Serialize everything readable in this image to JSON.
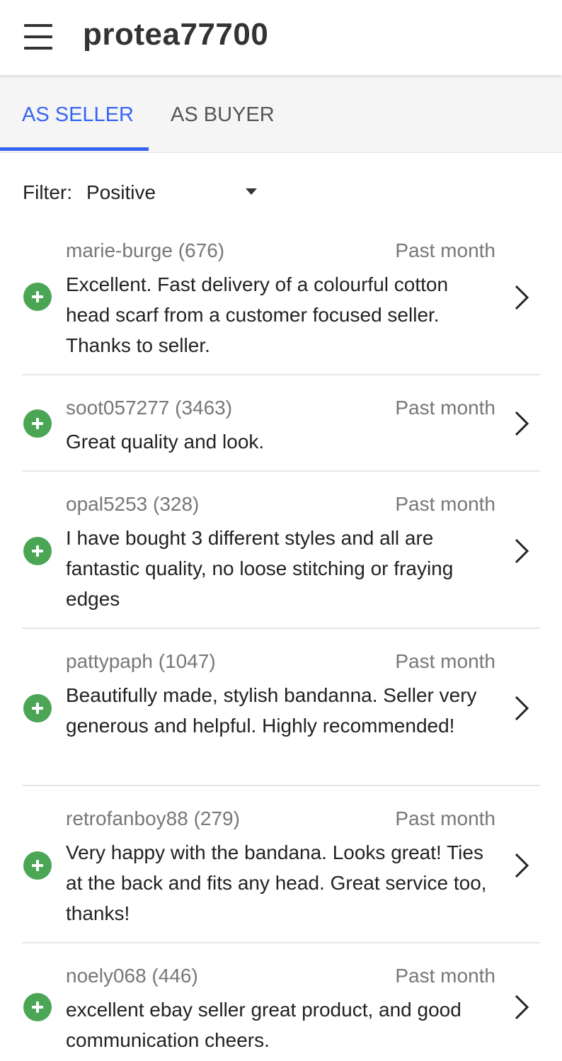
{
  "header": {
    "title": "protea77700",
    "menu_icon": "hamburger-menu-icon"
  },
  "tabs": [
    {
      "label": "AS SELLER",
      "selected": true
    },
    {
      "label": "AS BUYER",
      "selected": false
    }
  ],
  "filter": {
    "label": "Filter:",
    "value": "Positive"
  },
  "colors": {
    "accent": "#3665f3",
    "positive": "#4aa555",
    "muted_text": "#777777"
  },
  "feedback": [
    {
      "user": "marie-burge (676)",
      "time": "Past month",
      "comment": "Excellent. Fast delivery of a colourful cotton head scarf from a customer focused seller. Thanks to seller.",
      "rating_icon": "positive-plus-icon"
    },
    {
      "user": "soot057277 (3463)",
      "time": "Past month",
      "comment": "Great quality and look.",
      "rating_icon": "positive-plus-icon"
    },
    {
      "user": "opal5253 (328)",
      "time": "Past month",
      "comment": "I have bought 3 different styles and all are fantastic quality, no loose stitching or fraying edges",
      "rating_icon": "positive-plus-icon"
    },
    {
      "user": "pattypaph (1047)",
      "time": "Past month",
      "comment": "Beautifully made, stylish bandanna. Seller very generous and helpful.  Highly recommended!",
      "rating_icon": "positive-plus-icon"
    },
    {
      "user": "retrofanboy88 (279)",
      "time": "Past month",
      "comment": "Very happy with the bandana. Looks great! Ties at the back and fits any head. Great service too, thanks!",
      "rating_icon": "positive-plus-icon"
    },
    {
      "user": "noely068 (446)",
      "time": "Past month",
      "comment": "excellent ebay seller great product, and good communication cheers.",
      "rating_icon": "positive-plus-icon"
    }
  ]
}
